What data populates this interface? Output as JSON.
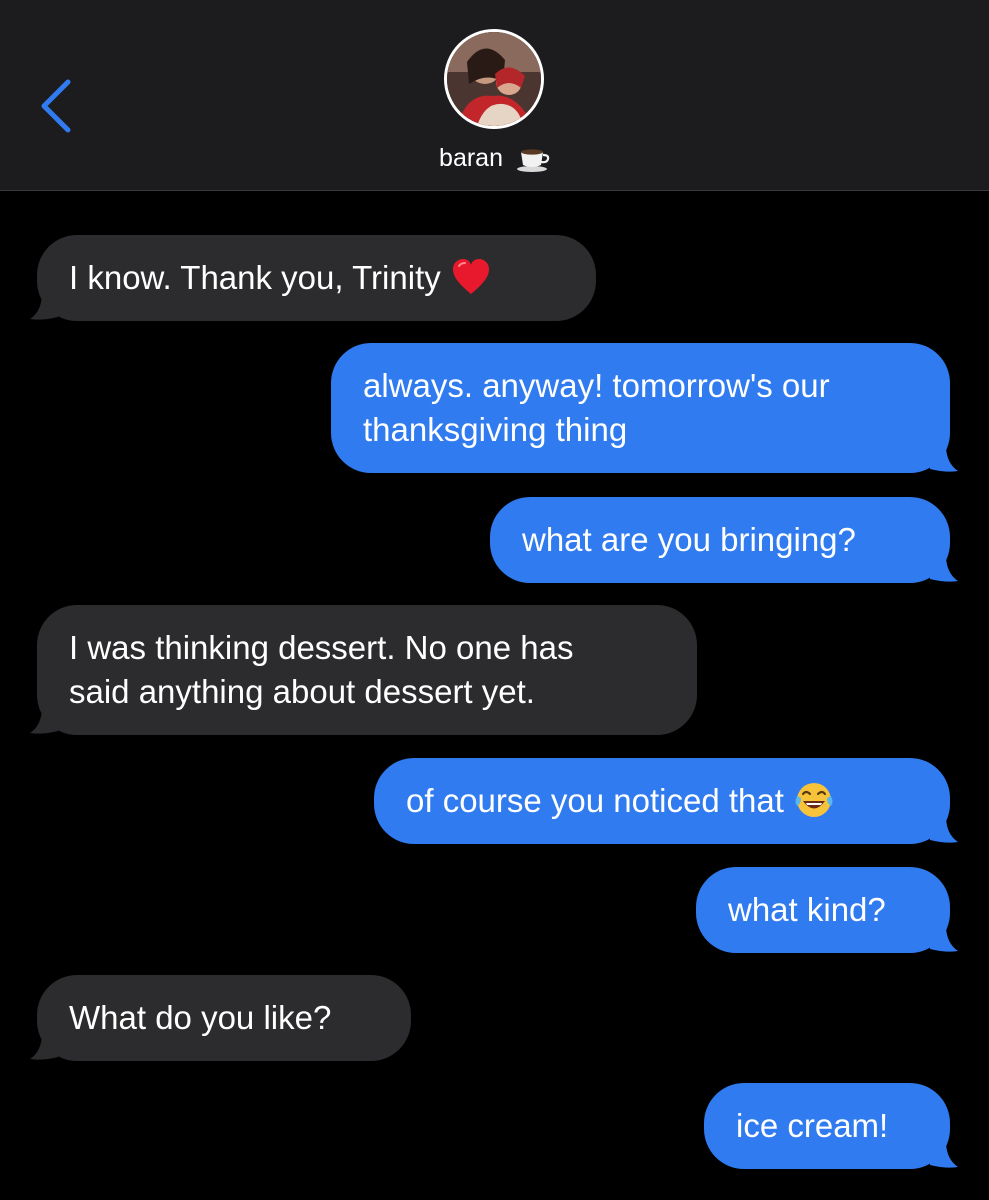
{
  "header": {
    "contact_name": "baran",
    "contact_emoji": "coffee-cup-icon",
    "back_icon": "chevron-left-icon",
    "accent_color": "#2f7bef",
    "background_color": "#1c1c1e"
  },
  "messages": [
    {
      "direction": "incoming",
      "lines": [
        "I know. Thank you, Trinity"
      ],
      "emoji": "red-heart-icon"
    },
    {
      "direction": "outgoing",
      "lines": [
        "always. anyway! tomorrow's our",
        "thanksgiving thing"
      ]
    },
    {
      "direction": "outgoing",
      "lines": [
        "what are you bringing?"
      ]
    },
    {
      "direction": "incoming",
      "lines": [
        "I was thinking dessert. No one has",
        "said anything about dessert yet."
      ]
    },
    {
      "direction": "outgoing",
      "lines": [
        "of course you noticed that"
      ],
      "emoji": "laughing-tears-icon"
    },
    {
      "direction": "outgoing",
      "lines": [
        "what kind?"
      ]
    },
    {
      "direction": "incoming",
      "lines": [
        "What do you like?"
      ]
    },
    {
      "direction": "outgoing",
      "lines": [
        "ice cream!"
      ]
    }
  ],
  "colors": {
    "incoming_bubble": "#2c2c2e",
    "outgoing_bubble": "#2f7bef",
    "thread_background": "#000000"
  }
}
